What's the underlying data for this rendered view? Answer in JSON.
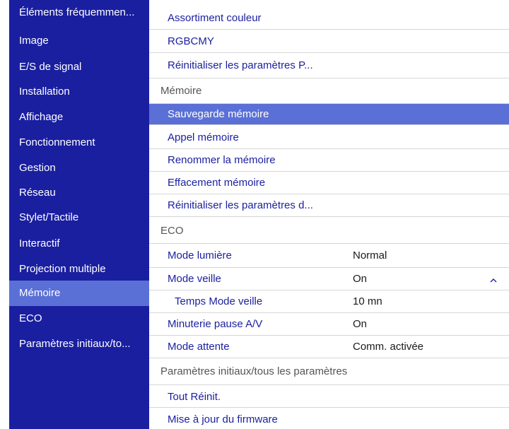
{
  "sidebar": {
    "items": [
      {
        "label": "Éléments fréquemmen..."
      },
      {
        "label": "Image"
      },
      {
        "label": "E/S de signal"
      },
      {
        "label": "Installation"
      },
      {
        "label": "Affichage"
      },
      {
        "label": "Fonctionnement"
      },
      {
        "label": "Gestion"
      },
      {
        "label": "Réseau"
      },
      {
        "label": "Stylet/Tactile"
      },
      {
        "label": "Interactif"
      },
      {
        "label": "Projection multiple"
      },
      {
        "label": "Mémoire"
      },
      {
        "label": "ECO"
      },
      {
        "label": "Paramètres initiaux/to..."
      }
    ],
    "selected_label": "Mémoire"
  },
  "main": {
    "items": [
      {
        "label": "Assortiment couleur"
      },
      {
        "label": "RGBCMY"
      },
      {
        "label": "Réinitialiser les paramètres P..."
      },
      {
        "label": "Mémoire"
      },
      {
        "label": "Sauvegarde mémoire"
      },
      {
        "label": "Appel mémoire"
      },
      {
        "label": "Renommer la mémoire"
      },
      {
        "label": "Effacement mémoire"
      },
      {
        "label": "Réinitialiser les paramètres d..."
      },
      {
        "label": "ECO"
      },
      {
        "label": "Mode lumière",
        "value": "Normal"
      },
      {
        "label": "Mode veille",
        "value": "On"
      },
      {
        "label": "Temps Mode veille",
        "value": "10 mn"
      },
      {
        "label": "Minuterie pause A/V",
        "value": "On"
      },
      {
        "label": "Mode attente",
        "value": "Comm. activée"
      },
      {
        "label": "Paramètres initiaux/tous les paramètres"
      },
      {
        "label": "Tout Réinit."
      },
      {
        "label": "Mise à jour du firmware"
      }
    ],
    "selected_label": "Sauvegarde mémoire"
  },
  "colors": {
    "sidebar_bg": "#1a1fa0",
    "highlight": "#5a70d6",
    "item_text": "#1a1fa0",
    "header_text": "#555555"
  },
  "icons": {
    "mode_veille_expand": "chevron-up-icon"
  }
}
